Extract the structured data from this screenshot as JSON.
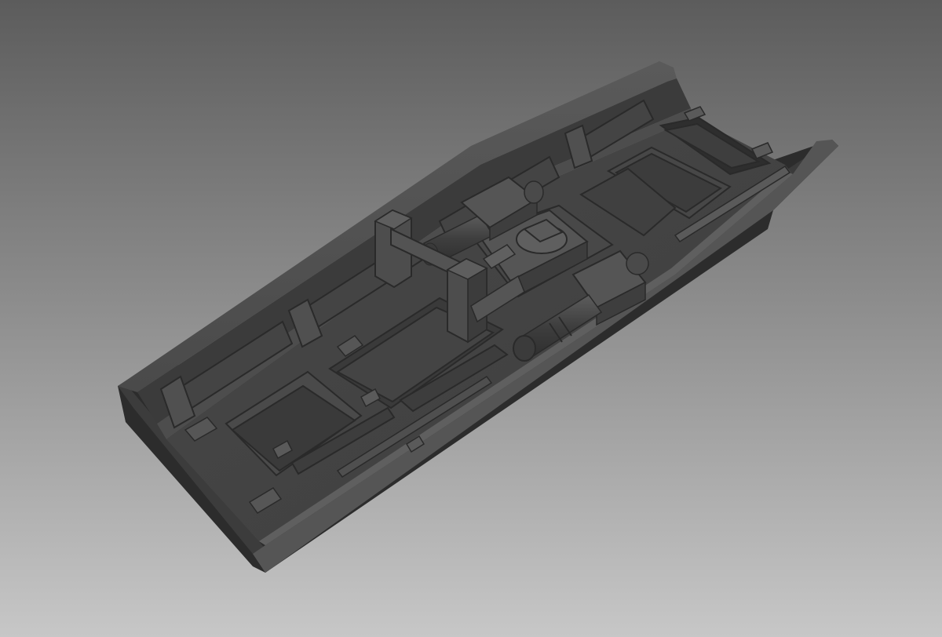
{
  "viewport": {
    "background_top": "#5c5c5c",
    "background_bottom": "#c7c7c7",
    "model_color": "#4a4a4a",
    "shading": "flat-grey"
  },
  "model": {
    "icon": "3d-model-icon"
  }
}
